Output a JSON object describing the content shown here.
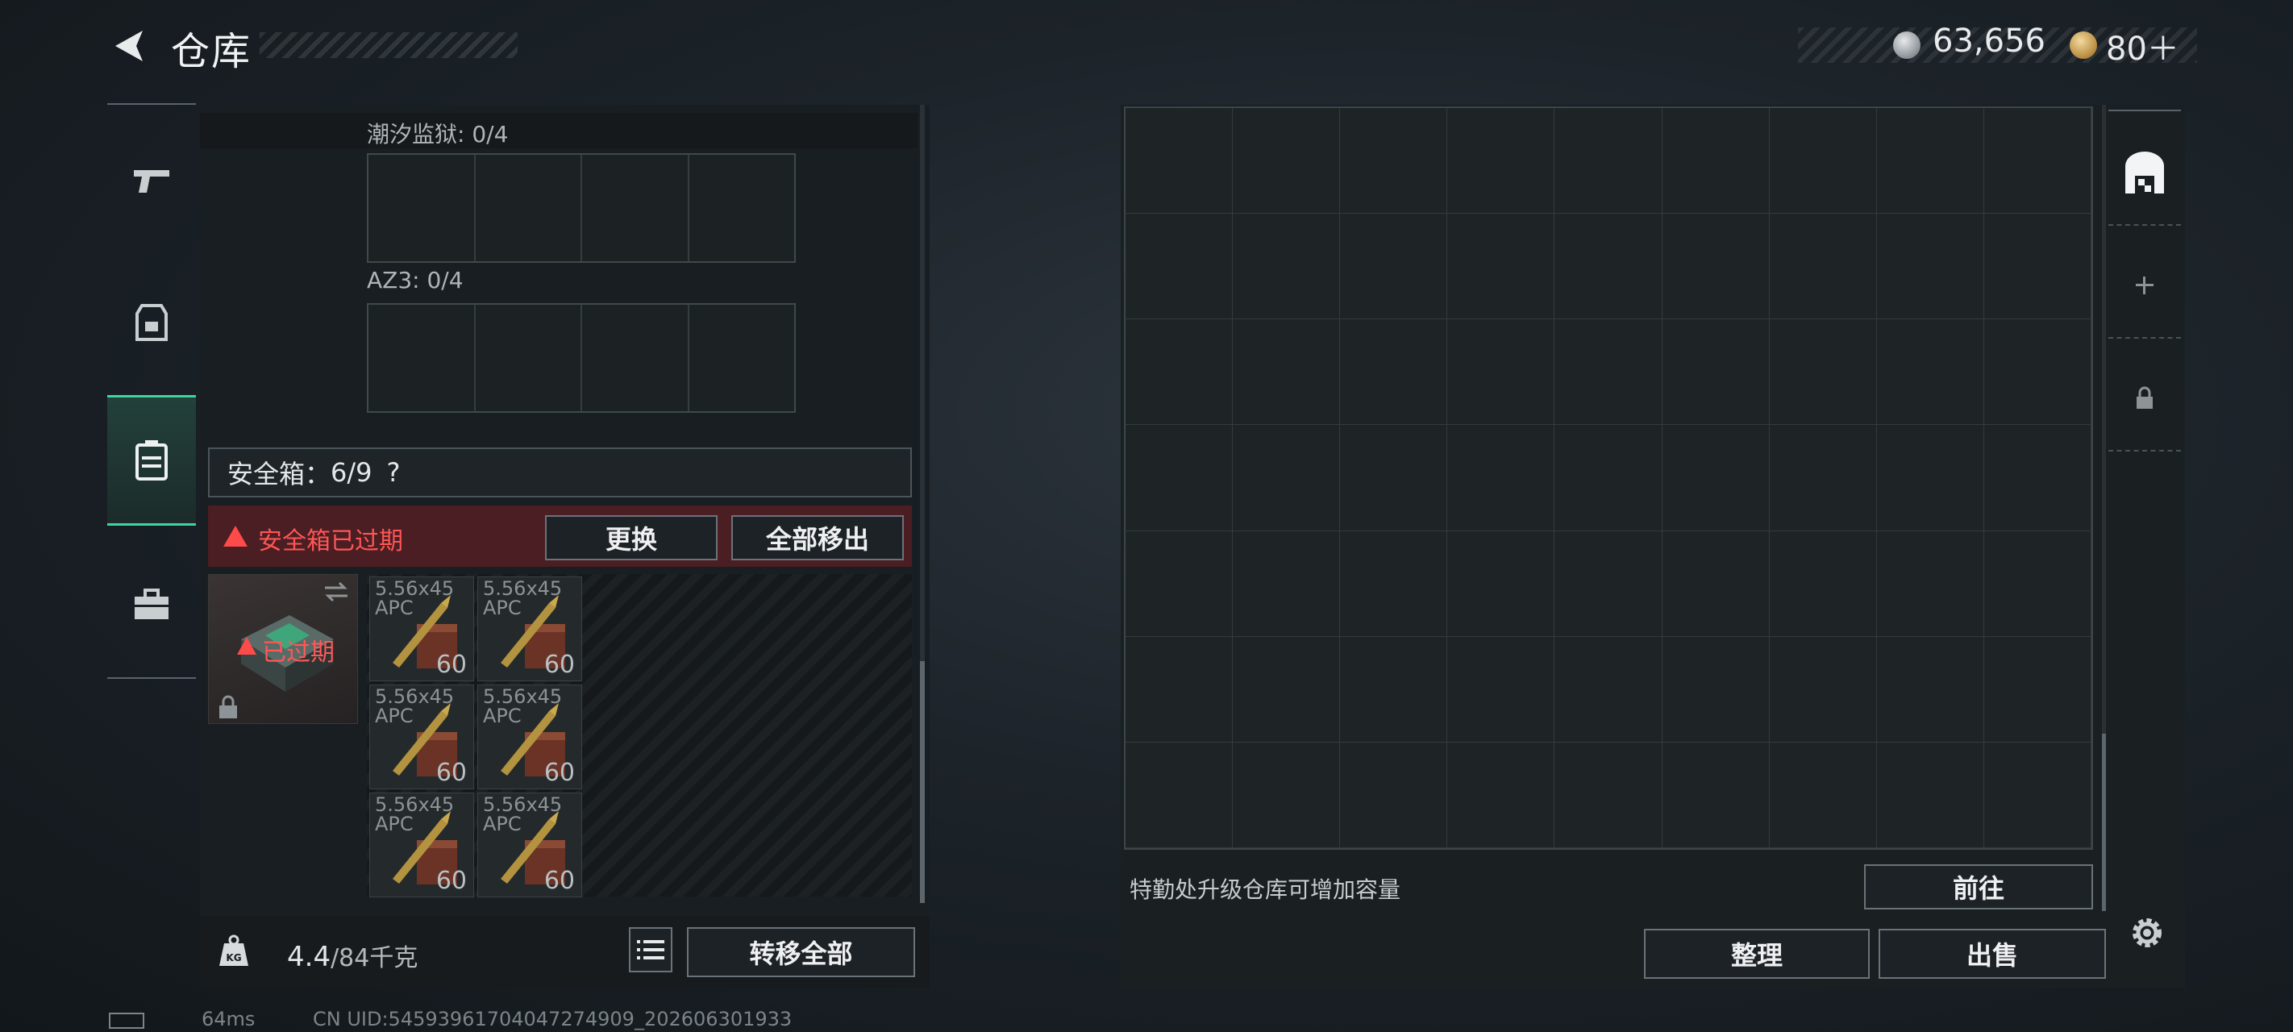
{
  "header": {
    "title": "仓库",
    "back_icon": "back-arrow-icon",
    "currency": [
      {
        "icon": "silver-coin-icon",
        "value": "63,656"
      },
      {
        "icon": "gold-coin-icon",
        "value": "80＋"
      }
    ]
  },
  "sidebar": {
    "items": [
      {
        "name": "weapons",
        "icon": "pistol-icon"
      },
      {
        "name": "armor",
        "icon": "vest-icon"
      },
      {
        "name": "backpack",
        "icon": "backpack-icon",
        "active": true
      },
      {
        "name": "toolbox",
        "icon": "toolbox-icon"
      }
    ]
  },
  "slots": [
    {
      "label": "潮汐监狱: 0/4"
    },
    {
      "label": "AZ3: 0/4"
    }
  ],
  "safebox": {
    "label": "安全箱：",
    "capacity": "6/9",
    "help": "?",
    "expired_warning": "安全箱已过期",
    "replace_button": "更换",
    "remove_all_button": "全部移出",
    "case_status": "已过期"
  },
  "ammo_items": [
    {
      "name_line1": "5.56x45",
      "name_line2": "APC",
      "count": "60"
    },
    {
      "name_line1": "5.56x45",
      "name_line2": "APC",
      "count": "60"
    },
    {
      "name_line1": "5.56x45",
      "name_line2": "APC",
      "count": "60"
    },
    {
      "name_line1": "5.56x45",
      "name_line2": "APC",
      "count": "60"
    },
    {
      "name_line1": "5.56x45",
      "name_line2": "APC",
      "count": "60"
    },
    {
      "name_line1": "5.56x45",
      "name_line2": "APC",
      "count": "60"
    }
  ],
  "weight": {
    "current": "4.4",
    "max_unit": "/84千克"
  },
  "transfer_all_button": "转移全部",
  "storage": {
    "upgrade_hint": "特勤处升级仓库可增加容量",
    "goto_button": "前往",
    "sort_button": "整理",
    "sell_button": "出售"
  },
  "status_bar": {
    "ping": "64ms",
    "uid": "CN UID:54593961704047274909_202606301933"
  },
  "colors": {
    "accent": "#3fd4a0",
    "warning": "#ff4a4a"
  }
}
